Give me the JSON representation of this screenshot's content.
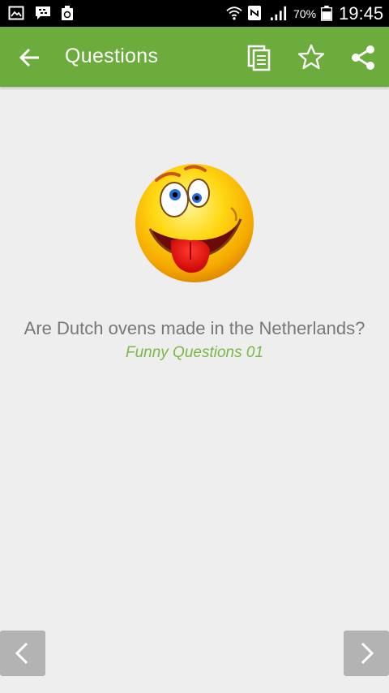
{
  "status_bar": {
    "battery_percent": "70%",
    "time": "19:45",
    "icons": [
      "gallery-icon",
      "bbm-icon",
      "recycle-icon",
      "wifi-icon",
      "nfc-icon",
      "signal-icon",
      "battery-icon"
    ]
  },
  "app_bar": {
    "title": "Questions",
    "background": "#6cac3c",
    "actions": [
      "copy-icon",
      "star-icon",
      "share-icon"
    ]
  },
  "content": {
    "question": "Are Dutch ovens made in the Netherlands?",
    "category": "Funny Questions 01",
    "image": "tongue-out-emoji"
  },
  "navigation": {
    "previous": "chevron-left-icon",
    "next": "chevron-right-icon"
  },
  "colors": {
    "accent": "#6cac3c",
    "category_text": "#7ab648",
    "question_text": "#777777",
    "background": "#eeeeee"
  }
}
